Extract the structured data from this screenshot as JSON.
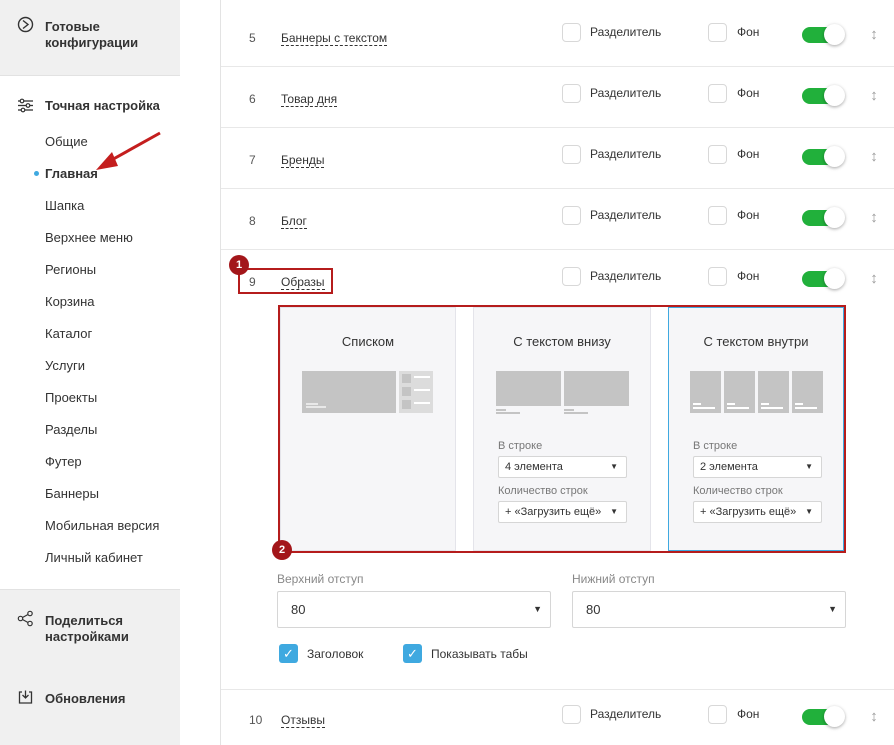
{
  "sidebar": {
    "ready_configs": "Готовые конфигурации",
    "fine_tuning": "Точная настройка",
    "items": [
      "Общие",
      "Главная",
      "Шапка",
      "Верхнее меню",
      "Регионы",
      "Корзина",
      "Каталог",
      "Услуги",
      "Проекты",
      "Разделы",
      "Футер",
      "Баннеры",
      "Мобильная версия",
      "Личный кабинет"
    ],
    "active_item": "Главная",
    "share": "Поделиться настройками",
    "updates": "Обновления"
  },
  "rows": [
    {
      "num": "5",
      "name": "Баннеры с текстом"
    },
    {
      "num": "6",
      "name": "Товар дня"
    },
    {
      "num": "7",
      "name": "Бренды"
    },
    {
      "num": "8",
      "name": "Блог"
    },
    {
      "num": "9",
      "name": "Образы"
    },
    {
      "num": "10",
      "name": "Отзывы"
    }
  ],
  "row_options": {
    "divider": "Разделитель",
    "background": "Фон"
  },
  "badges": [
    "1",
    "2"
  ],
  "views": {
    "list": {
      "title": "Списком"
    },
    "text_below": {
      "title": "С текстом внизу",
      "per_row_label": "В строке",
      "per_row_value": "4 элемента",
      "rows_label": "Количество строк",
      "rows_value": "+ «Загрузить ещё»"
    },
    "text_inside": {
      "title": "С текстом внутри",
      "per_row_label": "В строке",
      "per_row_value": "2 элемента",
      "rows_label": "Количество строк",
      "rows_value": "+ «Загрузить ещё»"
    }
  },
  "padding": {
    "top_label": "Верхний отступ",
    "top_value": "80",
    "bottom_label": "Нижний отступ",
    "bottom_value": "80"
  },
  "checks": {
    "header": "Заголовок",
    "tabs": "Показывать табы"
  },
  "colors": {
    "toggle_on": "#21b03b",
    "accent": "#3fa9e0",
    "annotation": "#b51c1c"
  }
}
